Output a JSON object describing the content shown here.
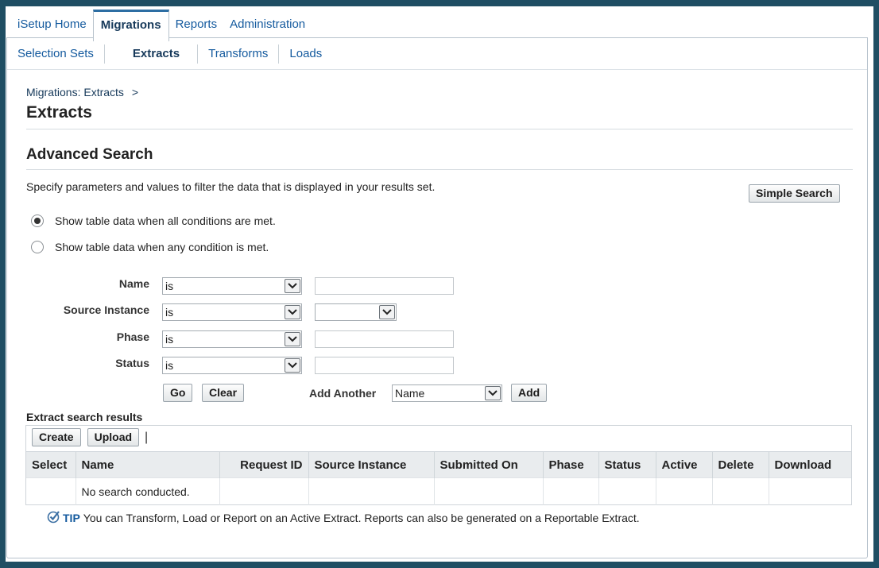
{
  "tabs": [
    "iSetup Home",
    "Migrations",
    "Reports",
    "Administration"
  ],
  "active_tab": "Migrations",
  "subtabs": [
    "Selection Sets",
    "Extracts",
    "Transforms",
    "Loads"
  ],
  "active_subtab": "Extracts",
  "breadcrumb": {
    "link": "Migrations: Extracts",
    "separator": ">"
  },
  "page_title": "Extracts",
  "section_title": "Advanced Search",
  "instructions": "Specify parameters and values to filter the data that is displayed in your results set.",
  "simple_search_label": "Simple Search",
  "radio": {
    "all": "Show table data when all conditions are met.",
    "any": "Show table data when any condition is met.",
    "selected": "all"
  },
  "fields": [
    {
      "label": "Name",
      "operator": "is",
      "value_type": "text",
      "value": ""
    },
    {
      "label": "Source Instance",
      "operator": "is",
      "value_type": "select",
      "value": ""
    },
    {
      "label": "Phase",
      "operator": "is",
      "value_type": "text",
      "value": ""
    },
    {
      "label": "Status",
      "operator": "is",
      "value_type": "text",
      "value": ""
    }
  ],
  "buttons": {
    "go": "Go",
    "clear": "Clear",
    "add": "Add",
    "create": "Create",
    "upload": "Upload"
  },
  "add_another": {
    "label": "Add Another",
    "selected": "Name"
  },
  "results_label": "Extract search results",
  "toolbar_separator": "|",
  "columns": [
    "Select",
    "Name",
    "Request ID",
    "Source Instance",
    "Submitted On",
    "Phase",
    "Status",
    "Active",
    "Delete",
    "Download"
  ],
  "empty_message": "No search conducted.",
  "tip": {
    "label": "TIP",
    "text": "You can Transform, Load or Report on an Active Extract. Reports can also be generated on a Reportable Extract."
  },
  "colors": {
    "background": "#1f4e63",
    "link": "#145a9e",
    "active_tab_border": "#2d6ea3"
  }
}
